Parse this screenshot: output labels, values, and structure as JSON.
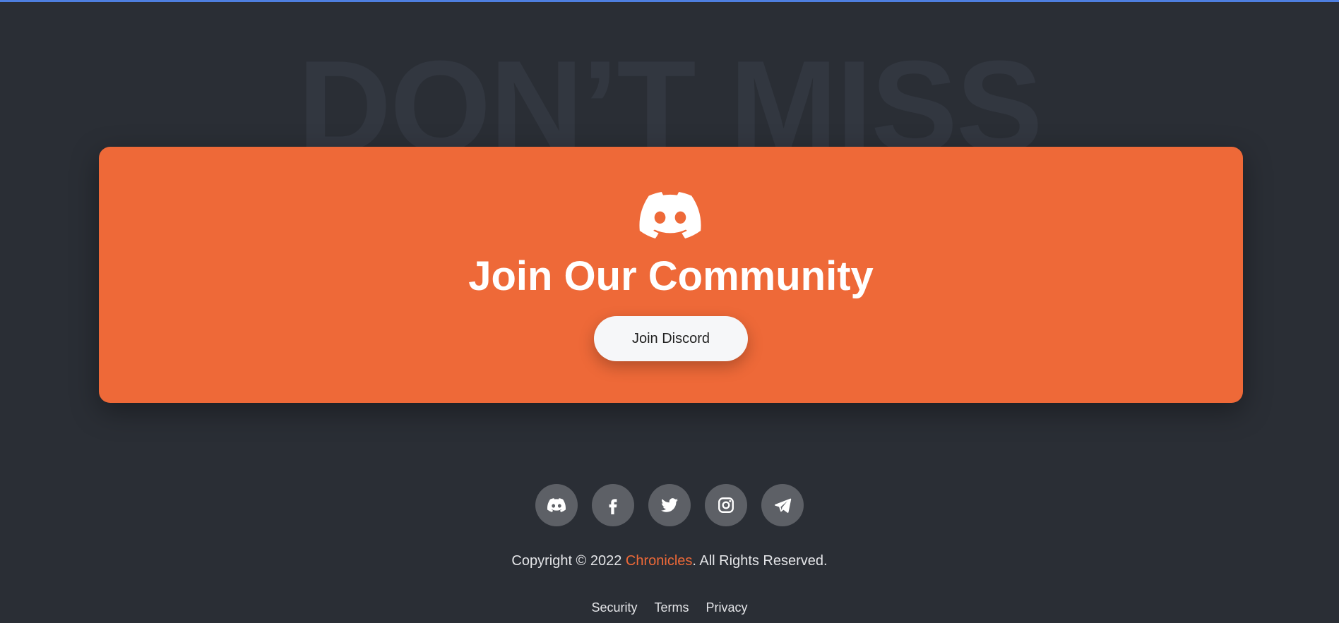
{
  "watermark": {
    "text": "DON’T MISS"
  },
  "cta": {
    "icon": "discord-icon",
    "title": "Join Our Community",
    "button_label": "Join Discord",
    "background": "#ee6938"
  },
  "socials": [
    {
      "icon": "discord-icon"
    },
    {
      "icon": "facebook-icon"
    },
    {
      "icon": "twitter-icon"
    },
    {
      "icon": "instagram-icon"
    },
    {
      "icon": "telegram-icon"
    }
  ],
  "footer": {
    "copyright_prefix": "Copyright © 2022 ",
    "brand": "Chronicles",
    "copyright_suffix": ". All Rights Reserved.",
    "links": [
      {
        "label": "Security"
      },
      {
        "label": "Terms"
      },
      {
        "label": "Privacy"
      }
    ]
  },
  "colors": {
    "page_background": "#2a2e35",
    "accent": "#ee6938",
    "top_border": "#4e7fe0"
  }
}
